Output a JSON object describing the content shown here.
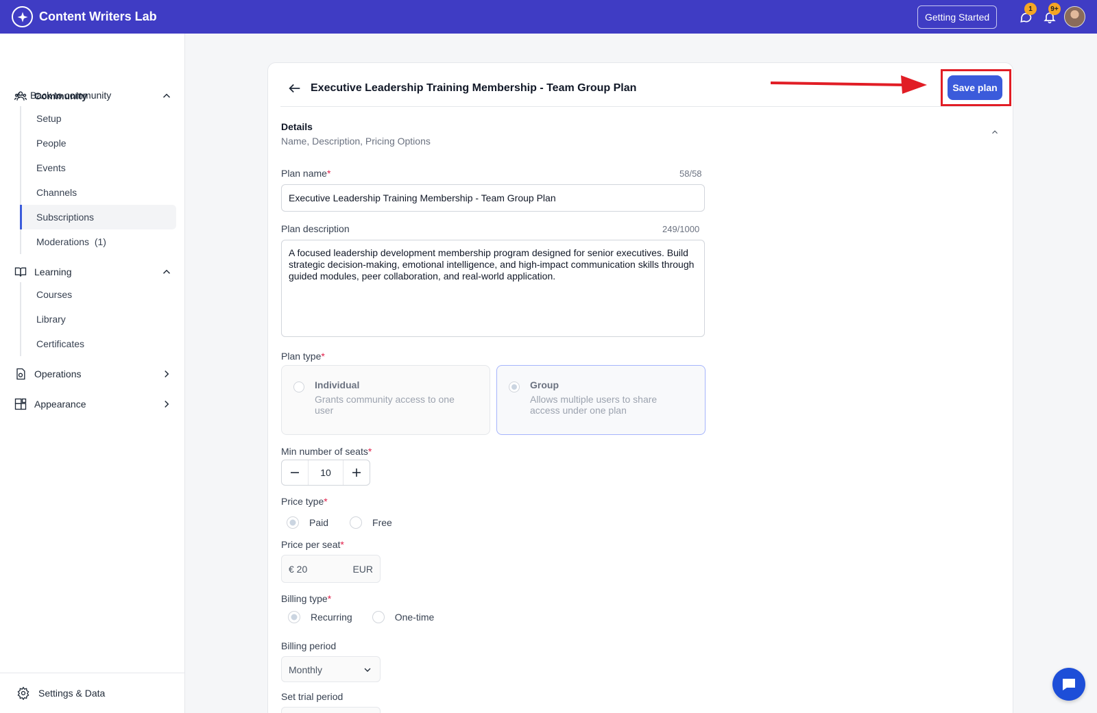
{
  "app": {
    "name": "Content Writers Lab"
  },
  "topbar": {
    "getting_started_label": "Getting Started",
    "messages_badge": "1",
    "notifications_badge": "9+"
  },
  "sidebar": {
    "back_label": "Back to community",
    "sections": [
      {
        "label": "Community",
        "expanded": true,
        "items": [
          "Setup",
          "People",
          "Events",
          "Channels",
          "Subscriptions",
          "Moderations  (1)"
        ],
        "active": "Subscriptions"
      },
      {
        "label": "Learning",
        "expanded": true,
        "items": [
          "Courses",
          "Library",
          "Certificates"
        ]
      },
      {
        "label": "Operations",
        "expanded": false
      },
      {
        "label": "Appearance",
        "expanded": false
      }
    ],
    "settings_label": "Settings & Data"
  },
  "plan": {
    "title": "Executive Leadership Training Membership - Team Group Plan",
    "save_label": "Save plan",
    "details": {
      "title": "Details",
      "subtitle": "Name, Description, Pricing Options"
    },
    "name": {
      "label": "Plan name",
      "counter": "58/58",
      "value": "Executive Leadership Training Membership - Team Group Plan"
    },
    "description": {
      "label": "Plan description",
      "counter": "249/1000",
      "value": "A focused leadership development membership program designed for senior executives. Build strategic decision-making, emotional intelligence, and high-impact communication skills through guided modules, peer collaboration, and real-world application."
    },
    "type": {
      "label": "Plan type",
      "options": [
        {
          "name": "Individual",
          "desc": "Grants community access to one user",
          "selected": false
        },
        {
          "name": "Group",
          "desc": "Allows multiple users to share access under one plan",
          "selected": true
        }
      ]
    },
    "seats": {
      "label": "Min number of seats",
      "value": "10"
    },
    "price_type": {
      "label": "Price type",
      "options": [
        "Paid",
        "Free"
      ],
      "selected": "Paid"
    },
    "price_per_seat": {
      "label": "Price per seat",
      "value": "€ 20",
      "currency": "EUR"
    },
    "billing_type": {
      "label": "Billing type",
      "options": [
        "Recurring",
        "One-time"
      ],
      "selected": "Recurring"
    },
    "billing_period": {
      "label": "Billing period",
      "value": "Monthly"
    },
    "trial": {
      "label": "Set trial period"
    }
  },
  "colors": {
    "brand": "#3f3cc4",
    "primary_button": "#3b5bdb",
    "annotation_red": "#e11d25"
  }
}
